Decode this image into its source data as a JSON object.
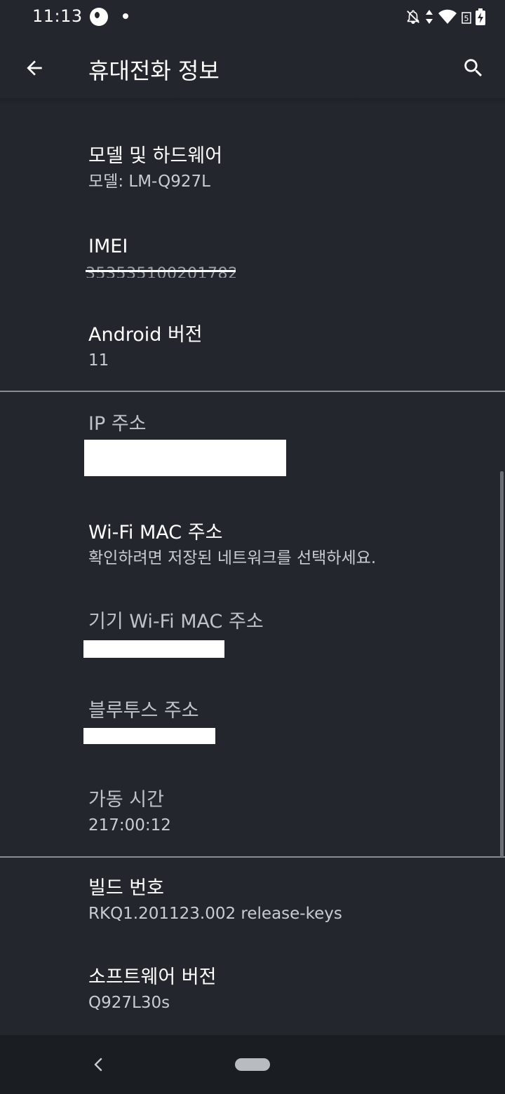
{
  "status_bar": {
    "time": "11:13",
    "icons": [
      "app-notification-icon",
      "dot-icon",
      "notifications-off-icon",
      "data-arrows-icon",
      "wifi-icon",
      "signal-5-icon",
      "battery-charging-icon"
    ]
  },
  "app_bar": {
    "title": "휴대전화 정보",
    "back_icon": "arrow-back-icon",
    "search_icon": "search-icon"
  },
  "items": [
    {
      "title": "모델 및 하드웨어",
      "value": "모델: LM-Q927L"
    },
    {
      "title": "IMEI",
      "value": "353535100201782"
    },
    {
      "title": "Android 버전",
      "value": "11"
    },
    {
      "title": "IP 주소",
      "value": ""
    },
    {
      "title": "Wi-Fi MAC 주소",
      "value": "확인하려면 저장된 네트워크를 선택하세요."
    },
    {
      "title": "기기 Wi-Fi MAC 주소",
      "value": ""
    },
    {
      "title": "블루투스 주소",
      "value": ""
    },
    {
      "title": "가동 시간",
      "value": "217:00:12"
    },
    {
      "title": "빌드 번호",
      "value": "RKQ1.201123.002 release-keys"
    },
    {
      "title": "소프트웨어 버전",
      "value": "Q927L30s"
    }
  ],
  "nav_bar": {
    "back_icon": "nav-back-icon",
    "home_icon": "home-pill-icon"
  }
}
